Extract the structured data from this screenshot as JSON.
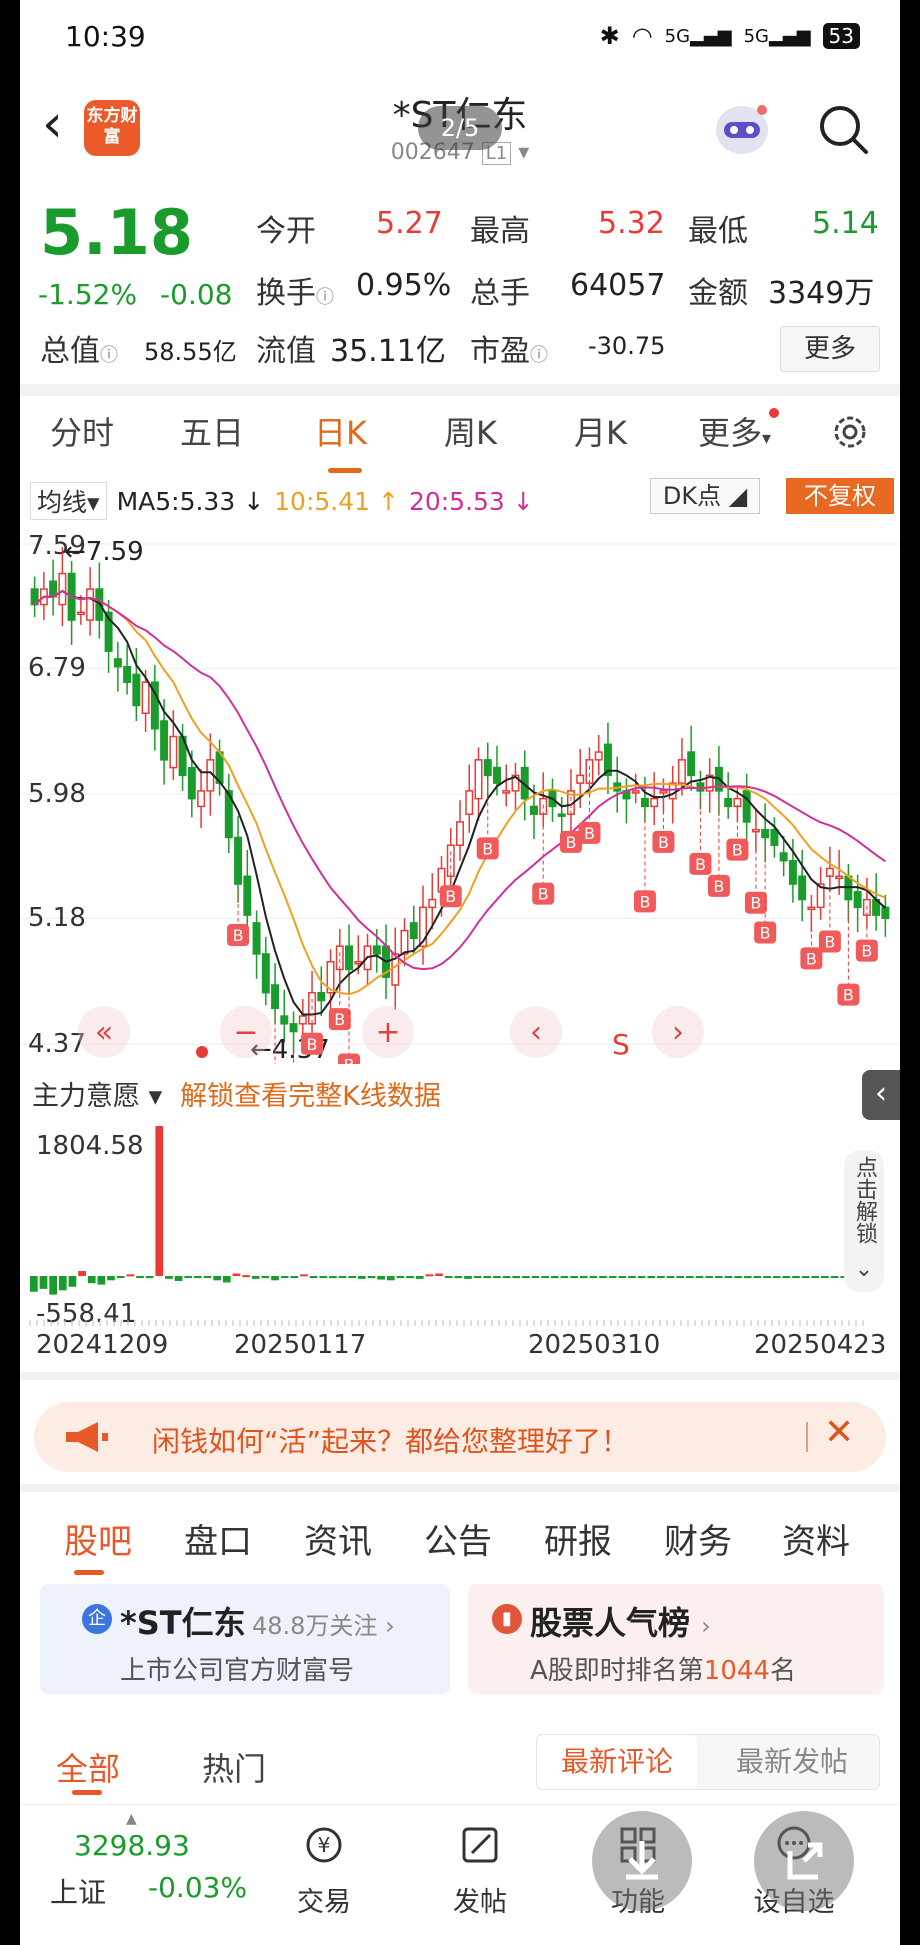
{
  "status_bar": {
    "time": "10:39",
    "battery": "53",
    "signal_labels": [
      "5G",
      "5G"
    ]
  },
  "header": {
    "logo_text": "东方财富",
    "title": "*ST仁东",
    "code": "002647",
    "level": "L1",
    "page_indicator": "2/5"
  },
  "quote": {
    "price": "5.18",
    "change_pct": "-1.52%",
    "change_abs": "-0.08",
    "open_label": "今开",
    "open": "5.27",
    "high_label": "最高",
    "high": "5.32",
    "low_label": "最低",
    "low": "5.14",
    "turnover_label": "换手",
    "turnover": "0.95%",
    "volume_label": "总手",
    "volume": "64057",
    "amount_label": "金额",
    "amount": "3349万",
    "mktcap_label": "总值",
    "mktcap": "58.55亿",
    "float_label": "流值",
    "float_cap": "35.11亿",
    "pe_label": "市盈",
    "pe": "-30.75",
    "more_label": "更多"
  },
  "k_tabs": [
    "分时",
    "五日",
    "日K",
    "周K",
    "月K",
    "更多"
  ],
  "ma_bar": {
    "selector": "均线",
    "ma5": "MA5:5.33 ↓",
    "ma10": "10:5.41 ↑",
    "ma20": "20:5.53 ↓",
    "dk_label": "DK点",
    "fuquan_label": "不复权"
  },
  "chart_data": {
    "type": "candlestick",
    "y_ticks": [
      "7.59",
      "6.79",
      "5.98",
      "5.18",
      "4.37"
    ],
    "ylim": [
      4.37,
      7.59
    ],
    "max_label": "7.59",
    "min_label": "4.37",
    "signal_labels": [
      "B",
      "S"
    ],
    "x_ticks": [
      "20241209",
      "20250117",
      "20250310",
      "20250423"
    ],
    "close": [
      7.2,
      7.3,
      7.25,
      7.4,
      7.1,
      7.15,
      7.3,
      7.1,
      6.9,
      6.8,
      6.7,
      6.55,
      6.7,
      6.4,
      6.2,
      6.35,
      6.1,
      5.95,
      6.0,
      6.2,
      6.05,
      5.7,
      5.4,
      5.2,
      4.95,
      4.7,
      4.6,
      4.5,
      4.45,
      4.55,
      4.7,
      4.65,
      4.9,
      5.0,
      4.85,
      4.9,
      5.0,
      4.95,
      4.8,
      4.95,
      5.1,
      5.05,
      5.25,
      5.3,
      5.5,
      5.65,
      5.8,
      6.0,
      6.2,
      6.1,
      6.05,
      6.0,
      6.1,
      5.95,
      5.85,
      5.95,
      5.9,
      5.85,
      6.0,
      6.1,
      6.2,
      6.25,
      6.1,
      6.0,
      5.95,
      6.0,
      5.9,
      5.95,
      6.0,
      6.05,
      6.2,
      6.1,
      6.0,
      6.1,
      6.0,
      5.9,
      5.95,
      5.8,
      5.75,
      5.7,
      5.65,
      5.55,
      5.4,
      5.3,
      5.25,
      5.4,
      5.5,
      5.45,
      5.3,
      5.25,
      5.3,
      5.2,
      5.18
    ],
    "ma5_label": "MA5",
    "ma10_label": "MA10",
    "ma20_label": "MA20"
  },
  "indicator": {
    "selector": "主力意愿",
    "unlock_text": "解锁查看完整K线数据",
    "side_unlock": "点击解锁",
    "y_top": "1804.58",
    "y_bottom": "-558.41",
    "values": [
      -220,
      -180,
      -260,
      -200,
      -150,
      60,
      -100,
      -120,
      -60,
      -20,
      20,
      -10,
      -30,
      1804,
      -40,
      -70,
      -20,
      -30,
      -10,
      -60,
      -90,
      30,
      10,
      -40,
      -30,
      -60,
      -20,
      -10,
      20,
      -10,
      -20,
      -30,
      -20,
      -10,
      -40,
      -30,
      -50,
      -60,
      -20,
      -30,
      -40,
      20,
      30,
      -10,
      -30,
      -40,
      -20,
      -30,
      -10,
      -20,
      -30,
      -20,
      -10,
      -20,
      -30,
      -20,
      -10,
      -30,
      -20,
      -10,
      -20,
      -10,
      -10,
      -20,
      -30,
      -10,
      -10,
      -20,
      -10,
      -20,
      -10,
      -20,
      -10,
      -20,
      -30,
      -20,
      -10,
      -10,
      -20,
      -10,
      -20,
      -10,
      -10,
      -20,
      -10
    ]
  },
  "banner": {
    "text": "闲钱如何“活”起来？都给您整理好了！"
  },
  "bottom_tabs": [
    "股吧",
    "盘口",
    "资讯",
    "公告",
    "研报",
    "财务",
    "资料"
  ],
  "cards": {
    "left": {
      "icon": "企",
      "title": "*ST仁东",
      "follow": "48.8万关注",
      "sub": "上市公司官方财富号"
    },
    "right": {
      "title": "股票人气榜",
      "sub_prefix": "A股即时排名第",
      "rank": "1044",
      "sub_suffix": "名"
    }
  },
  "sub_tabs": {
    "all": "全部",
    "hot": "热门",
    "latest_comment": "最新评论",
    "latest_post": "最新发帖"
  },
  "bottom_nav": {
    "index_value": "3298.93",
    "index_name": "上证",
    "index_change": "-0.03%",
    "trade": "交易",
    "post": "发帖",
    "func": "功能",
    "watchlist": "设自选"
  },
  "colors": {
    "up": "#e83b36",
    "down": "#1a9c2c",
    "accent": "#e8592a",
    "ma5": "#222222",
    "ma10": "#f0a020",
    "ma20": "#d0309a"
  }
}
